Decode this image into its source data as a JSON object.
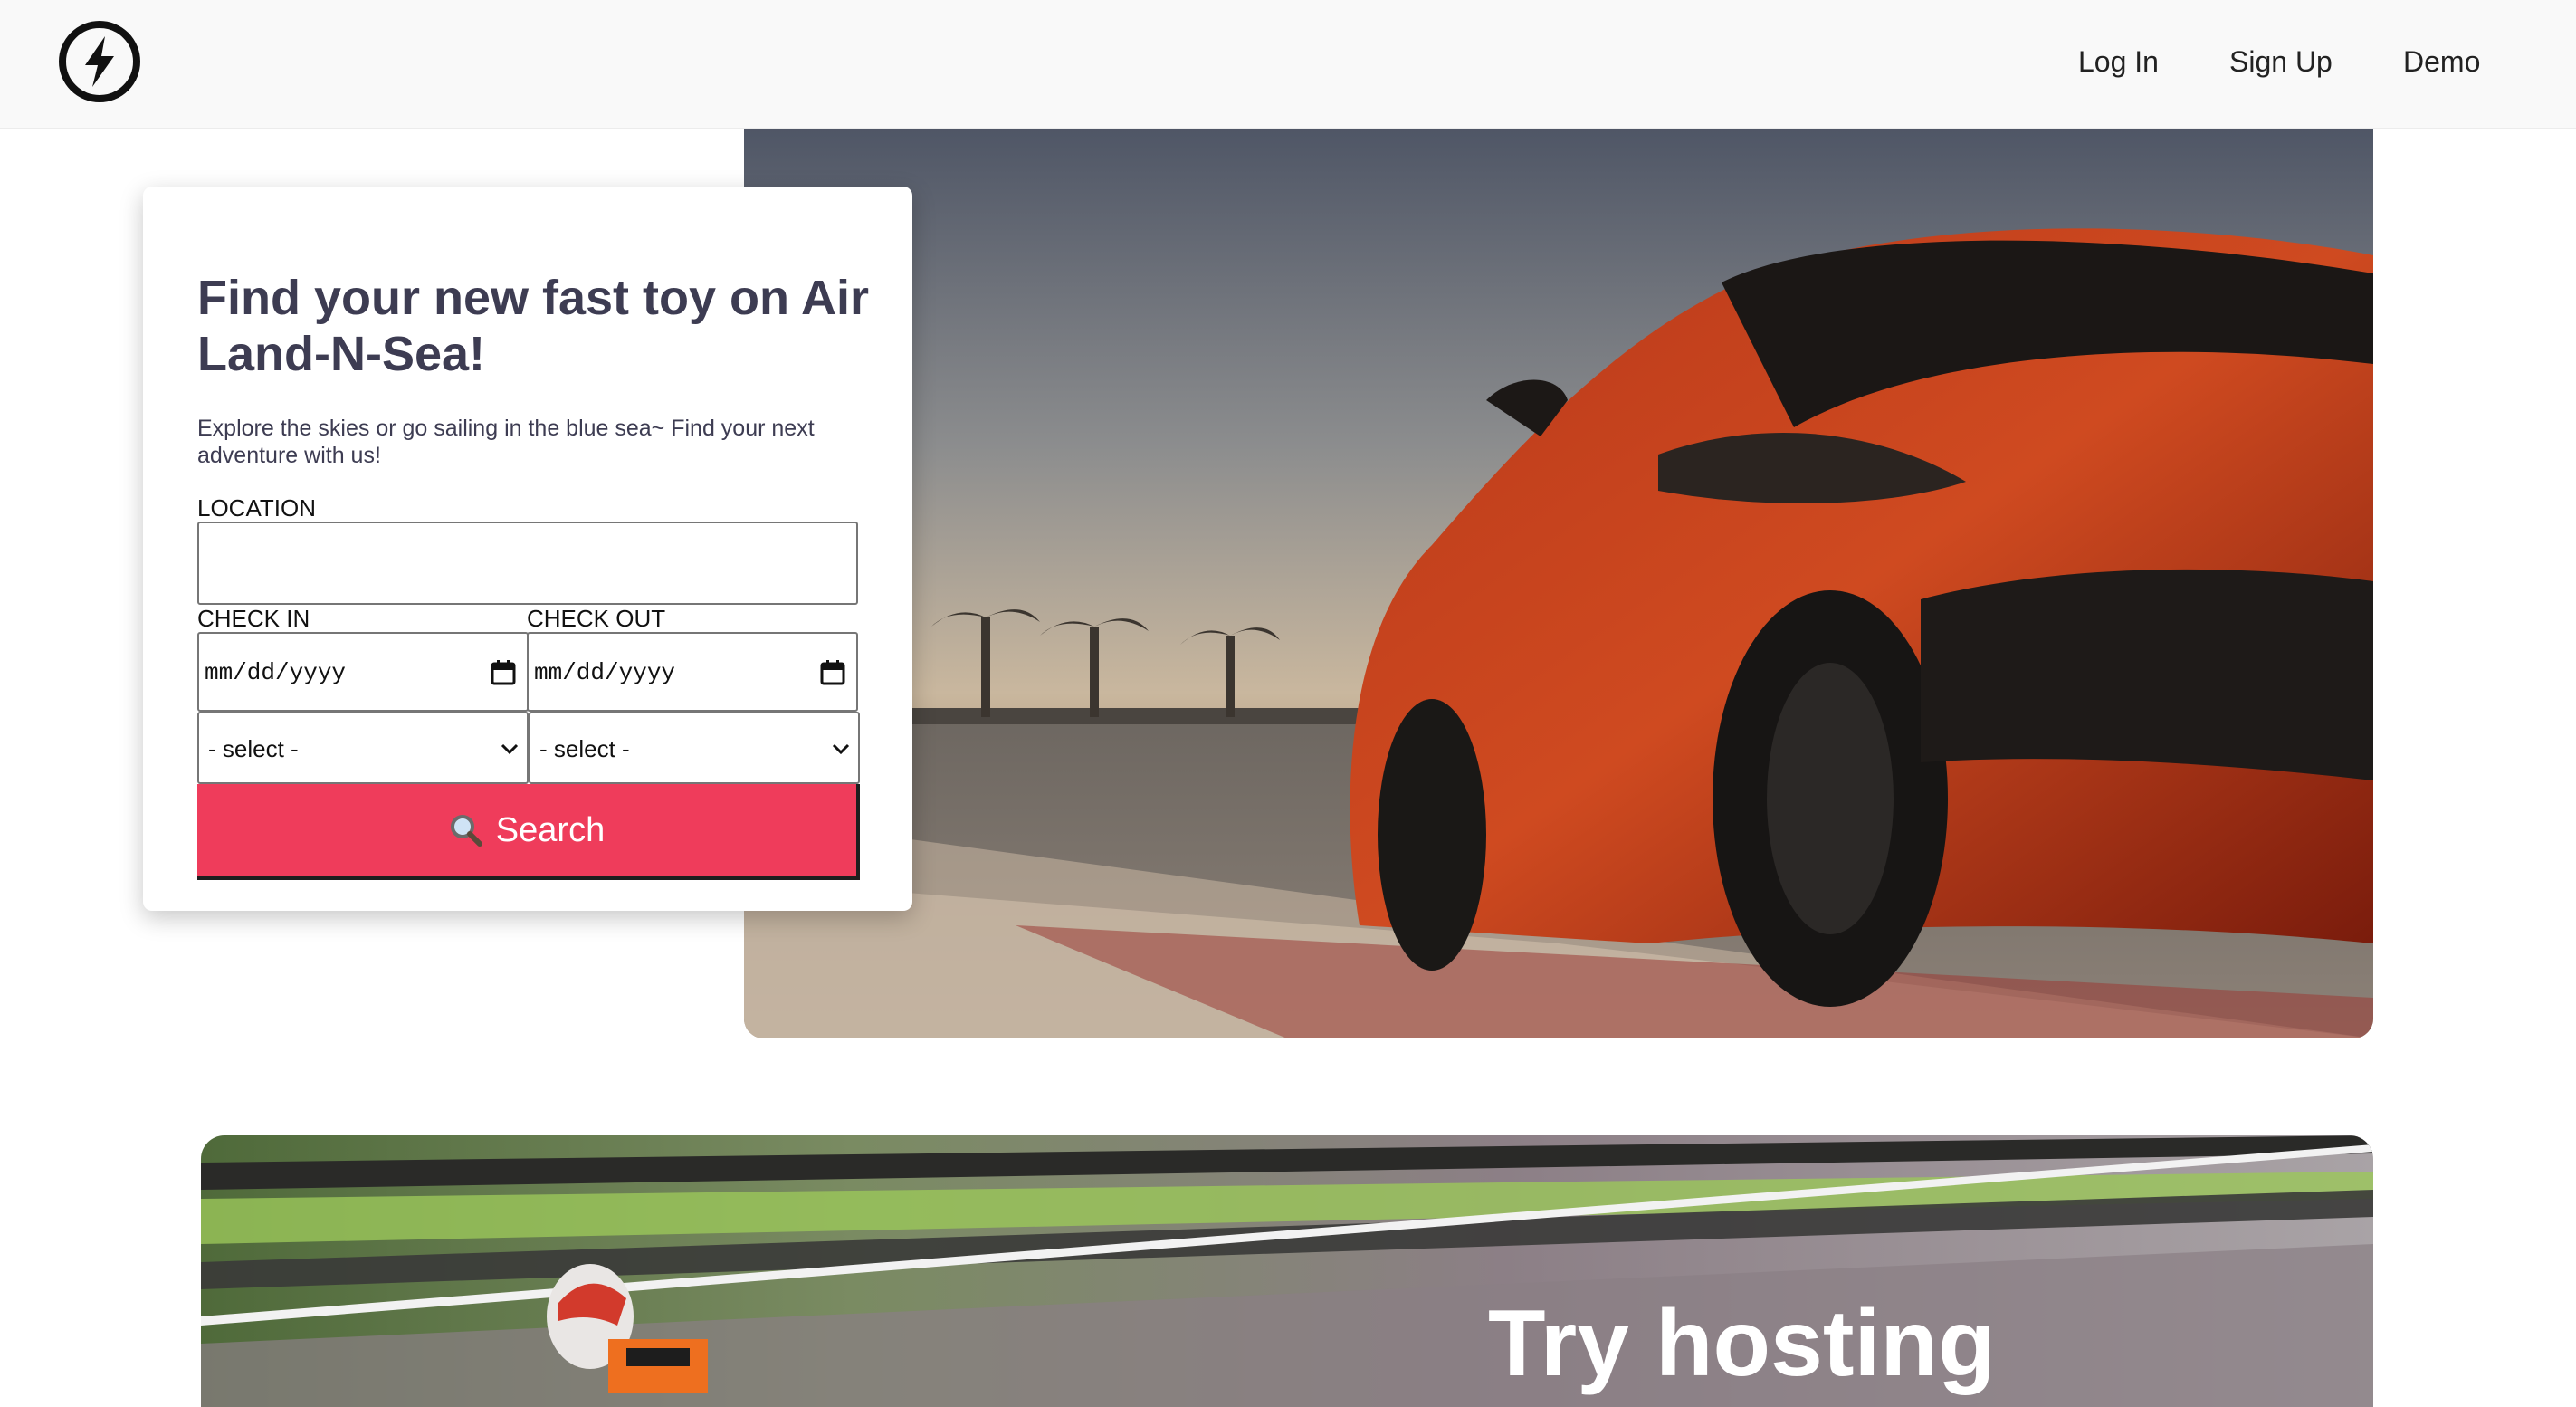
{
  "header": {
    "logo_icon": "lightning-bolt-circle-icon",
    "nav": {
      "login_label": "Log In",
      "signup_label": "Sign Up",
      "demo_label": "Demo"
    }
  },
  "search_card": {
    "title": "Find your new fast toy on Air Land-N-Sea!",
    "subtitle": "Explore the skies or go sailing in the blue sea~ Find your next adventure with us!",
    "location_label": "LOCATION",
    "location_value": "",
    "checkin_label": "CHECK IN",
    "checkout_label": "CHECK OUT",
    "checkin_value": "mm/dd/yyyy",
    "checkout_value": "mm/dd/yyyy",
    "select_a_value": "- select -",
    "select_b_value": "- select -",
    "search_button_label": "Search",
    "search_button_icon": "magnifier-icon",
    "accent_color": "#ef3c5b"
  },
  "hero": {
    "image": "red-sports-car-on-racetrack"
  },
  "banner": {
    "image": "motorcycle-racer-motion-blur",
    "title": "Try hosting"
  }
}
